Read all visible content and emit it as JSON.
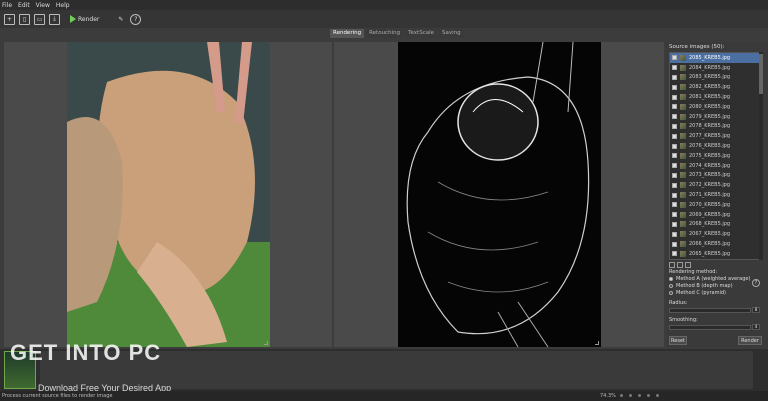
{
  "menu": [
    "File",
    "Edit",
    "View",
    "Help"
  ],
  "toolbar": {
    "render_label": "Render",
    "help": "?"
  },
  "tabs": [
    "Rendering",
    "Retouching",
    "TextScale",
    "Saving"
  ],
  "source": {
    "title": "Source images (50):",
    "files": [
      "2085_KREB5.jpg",
      "2084_KREB5.jpg",
      "2083_KREB5.jpg",
      "2082_KREB5.jpg",
      "2081_KREB5.jpg",
      "2080_KREB5.jpg",
      "2079_KREB5.jpg",
      "2078_KREB5.jpg",
      "2077_KREB5.jpg",
      "2076_KREB5.jpg",
      "2075_KREB5.jpg",
      "2074_KREB5.jpg",
      "2073_KREB5.jpg",
      "2072_KREB5.jpg",
      "2071_KREB5.jpg",
      "2070_KREB5.jpg",
      "2069_KREB5.jpg",
      "2068_KREB5.jpg",
      "2067_KREB5.jpg",
      "2066_KREB5.jpg",
      "2065_KREB5.jpg"
    ]
  },
  "rendering": {
    "title": "Rendering method:",
    "methods": [
      "Method A (weighted average)",
      "Method B (depth map)",
      "Method C (pyramid)"
    ],
    "radius_label": "Radius:",
    "radius_value": "8",
    "smoothing_label": "Smoothing:",
    "smoothing_value": "4",
    "reset_label": "Reset",
    "render_label": "Render"
  },
  "watermark": {
    "title": "GET INTO PC",
    "subtitle": "Download Free Your Desired App"
  },
  "status": {
    "text": "Process current source files to render image",
    "zoom": "74.3%"
  },
  "colors": {
    "accent": "#6fcf5a",
    "selection": "#4a6fa0"
  }
}
